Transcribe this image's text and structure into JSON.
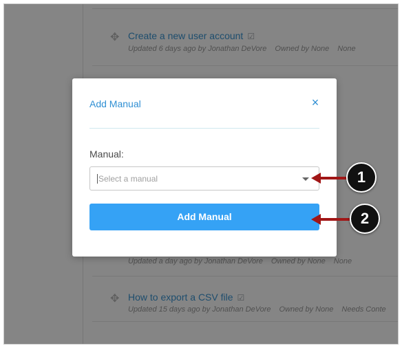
{
  "background_list": {
    "items": [
      {
        "title": "Create a new user account",
        "meta": [
          "Updated 6 days ago by Jonathan DeVore",
          "Owned by None",
          "None"
        ]
      },
      {
        "title": "",
        "meta": [
          "Updated a day ago by Jonathan DeVore",
          "Owned by None",
          "None"
        ]
      },
      {
        "title": "How to export a CSV file",
        "meta": [
          "Updated 15 days ago by Jonathan DeVore",
          "Owned by None",
          "Needs Conte"
        ]
      }
    ]
  },
  "modal": {
    "title": "Add Manual",
    "close_glyph": "×",
    "field_label": "Manual:",
    "select_placeholder": "Select a manual",
    "submit_label": "Add Manual"
  },
  "callouts": {
    "one": "1",
    "two": "2"
  },
  "colors": {
    "accent": "#35a2f5",
    "title_blue": "#2f8fd3",
    "callout_arrow": "#a11616"
  }
}
